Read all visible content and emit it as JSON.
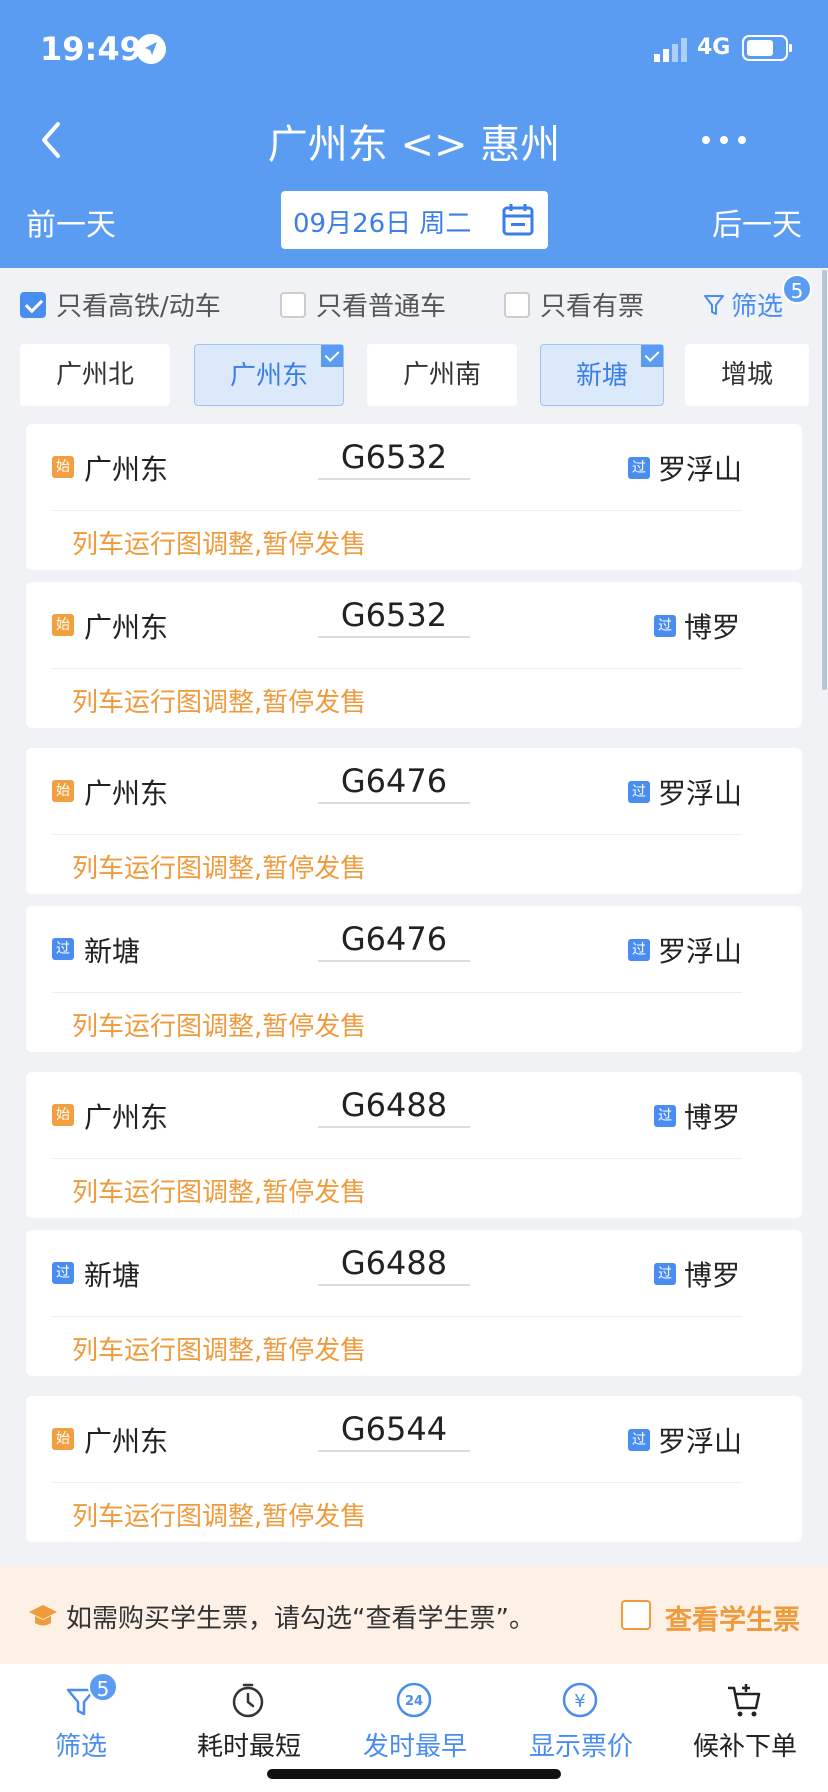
{
  "status": {
    "time": "19:49",
    "network": "4G"
  },
  "header": {
    "title": "广州东 <> 惠州",
    "prev_day": "前一天",
    "next_day": "后一天",
    "date": "09月26日 周二"
  },
  "filters": {
    "high_speed": {
      "label": "只看高铁/动车",
      "checked": true
    },
    "normal": {
      "label": "只看普通车",
      "checked": false
    },
    "available": {
      "label": "只看有票",
      "checked": false
    },
    "filter_label": "筛选",
    "filter_badge": "5"
  },
  "stations": [
    {
      "name": "广州北",
      "selected": false
    },
    {
      "name": "广州东",
      "selected": true
    },
    {
      "name": "广州南",
      "selected": false
    },
    {
      "name": "新塘",
      "selected": true
    },
    {
      "name": "增城",
      "selected": false
    }
  ],
  "trains": [
    {
      "from_tag": "始",
      "from": "广州东",
      "train_no": "G6532",
      "to_tag": "过",
      "to": "罗浮山",
      "message": "列车运行图调整,暂停发售"
    },
    {
      "from_tag": "始",
      "from": "广州东",
      "train_no": "G6532",
      "to_tag": "过",
      "to": "博罗",
      "message": "列车运行图调整,暂停发售"
    },
    {
      "from_tag": "始",
      "from": "广州东",
      "train_no": "G6476",
      "to_tag": "过",
      "to": "罗浮山",
      "message": "列车运行图调整,暂停发售"
    },
    {
      "from_tag": "过",
      "from": "新塘",
      "train_no": "G6476",
      "to_tag": "过",
      "to": "罗浮山",
      "message": "列车运行图调整,暂停发售"
    },
    {
      "from_tag": "始",
      "from": "广州东",
      "train_no": "G6488",
      "to_tag": "过",
      "to": "博罗",
      "message": "列车运行图调整,暂停发售"
    },
    {
      "from_tag": "过",
      "from": "新塘",
      "train_no": "G6488",
      "to_tag": "过",
      "to": "博罗",
      "message": "列车运行图调整,暂停发售"
    },
    {
      "from_tag": "始",
      "from": "广州东",
      "train_no": "G6544",
      "to_tag": "过",
      "to": "罗浮山",
      "message": "列车运行图调整,暂停发售"
    }
  ],
  "student": {
    "text": "如需购买学生票，请勾选“查看学生票”。",
    "label": "查看学生票",
    "checked": false
  },
  "bottom_nav": [
    {
      "label": "筛选",
      "icon": "funnel-icon",
      "badge": "5",
      "active": true
    },
    {
      "label": "耗时最短",
      "icon": "clock-icon",
      "active": false
    },
    {
      "label": "发时最早",
      "icon": "clock-24-icon",
      "icon_text": "24",
      "active": true
    },
    {
      "label": "显示票价",
      "icon": "yuan-icon",
      "icon_text": "¥",
      "active": true
    },
    {
      "label": "候补下单",
      "icon": "cart-icon",
      "active": false
    }
  ],
  "colors": {
    "primary": "#5b9cf3",
    "accent_blue": "#4a8df0",
    "warning_orange": "#ef9a3c"
  }
}
